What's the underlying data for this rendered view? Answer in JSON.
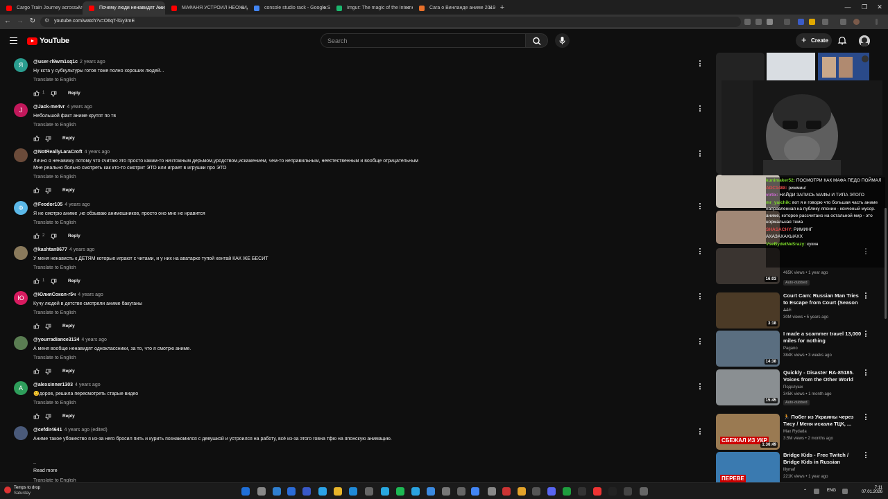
{
  "browser": {
    "tabs": [
      {
        "label": "Cargo Train Journey across Arg...",
        "color": "#ff0000"
      },
      {
        "label": "Почему люди ненавидят Аниме",
        "color": "#ff0000",
        "active": true
      },
      {
        "label": "МАФАНЯ УСТРОИЛ НЕОЖИДА...",
        "color": "#ff0000"
      },
      {
        "label": "console studio rack - Google Se...",
        "color": "#4285f4"
      },
      {
        "label": "Imgur: The magic of the Interne...",
        "color": "#1bb76e"
      },
      {
        "label": "Сага о Винланде аниме 2019-...",
        "color": "#e8702a"
      }
    ],
    "new_tab": "+",
    "close_glyph": "×",
    "url": "youtube.com/watch?v=O6qT-lGy3mE"
  },
  "header": {
    "logo_text": "YouTube",
    "search_placeholder": "Search",
    "create_label": "Create"
  },
  "comments": [
    {
      "avatar_letter": "Я",
      "avatar_color": "#2a9d8f",
      "handle": "@user-rl9wm1sq1c",
      "time": "2 years ago",
      "text": "Ну кста у субкультуры готов тоже полно хороших людей...",
      "translate": "Translate to English",
      "likes": "1",
      "reply": "Reply"
    },
    {
      "avatar_letter": "J",
      "avatar_color": "#c2185b",
      "handle": "@Jack-me4vr",
      "time": "4 years ago",
      "text": "Небольшой факт аниме крутят по тв",
      "translate": "Translate to English",
      "likes": "",
      "reply": "Reply"
    },
    {
      "avatar_letter": "",
      "avatar_color": "#6b4b3a",
      "handle": "@NotReallyLaraCroft",
      "time": "4 years ago",
      "text": "Лично я ненавижу потому что считаю это просто каким-то ничтожным дерьмом,уродством,искажением, чем-то неправильным, неестественным и вообще отрицательным",
      "text2": "Мне реально больно смотреть как кто-то смотрит ЭТО или играет в игрушки про ЭТО",
      "translate": "Translate to English",
      "likes": "",
      "reply": "Reply"
    },
    {
      "avatar_letter": "Ф",
      "avatar_color": "#5bb8e8",
      "handle": "@Feodor105",
      "time": "4 years ago",
      "text": "Я не смотрю аниме ,не обзываю анимешников, просто оно мне не нравится",
      "translate": "Translate to English",
      "likes": "2",
      "reply": "Reply"
    },
    {
      "avatar_letter": "",
      "avatar_color": "#8a7a5c",
      "handle": "@kashtan8677",
      "time": "4 years ago",
      "text": "У меня ненависть к ДЕТЯМ которые играют с читами, и у них на аватарке тупой хентай КАК ЖЕ БЕСИТ",
      "translate": "Translate to English",
      "likes": "1",
      "reply": "Reply"
    },
    {
      "avatar_letter": "Ю",
      "avatar_color": "#d81b60",
      "handle": "@ЮлияСокол-г5ч",
      "time": "4 years ago",
      "text": "Кучу людей в детстве смотрели аниме  бакуганы",
      "translate": "Translate to English",
      "likes": "",
      "reply": "Reply"
    },
    {
      "avatar_letter": "",
      "avatar_color": "#5a7d52",
      "handle": "@yourradiance3134",
      "time": "4 years ago",
      "text": "А меня вообще ненавидят одноклассники, за то, что я смотрю аниме.",
      "translate": "Translate to English",
      "likes": "",
      "reply": "Reply"
    },
    {
      "avatar_letter": "A",
      "avatar_color": "#2e9e5b",
      "handle": "@alexsinner1303",
      "time": "4 years ago",
      "text": "😊доров, решила пересмотреть старые видео",
      "translate": "Translate to English",
      "likes": "",
      "reply": "Reply"
    },
    {
      "avatar_letter": "",
      "avatar_color": "#4a5a7a",
      "handle": "@cefdir4641",
      "time": "4 years ago (edited)",
      "text": "Аниме такое убожество я из-за него бросил пить и курить познакомился с девушкой и устроился на работу, всё из-за этого говна тфю на японскую анимацию.",
      "text2": "..",
      "translate": "",
      "likes": "",
      "reply": ""
    }
  ],
  "read_more": "Read more",
  "last_translate": "Translate to English",
  "sidebar": {
    "videos": [
      {
        "title": "",
        "channel": "",
        "meta": "465K views • 1 year ago",
        "badge": "Auto-dubbed",
        "duration": "16:03",
        "thumb": "#3a3430"
      },
      {
        "title": "Court Cam: Russian Man Tries to Escape from Court (Season ...",
        "channel": "A&E",
        "meta": "30M views • 5 years ago",
        "badge": "",
        "duration": "3:18",
        "thumb": "#4b3a26"
      },
      {
        "title": "I made a scammer travel 13,000 miles for nothing",
        "channel": "Pagano",
        "meta": "384K views • 3 weeks ago",
        "badge": "",
        "duration": "14:38",
        "thumb": "#5a6e80"
      },
      {
        "title": "Quickly - Disaster RA-85185. Voices from the Other World",
        "channel": "Подслушх",
        "meta": "345K views • 1 month ago",
        "badge": "Auto-dubbed",
        "duration": "15:45",
        "thumb": "#8a8f92"
      },
      {
        "title": "🏃 Побег из Украины через Тису / Меня искали ТЦК, ...",
        "channel": "Max Rydada",
        "meta": "3.5M views • 2 months ago",
        "badge": "",
        "duration": "1:36:49",
        "thumb": "#9a7a52",
        "thumb_text": "СБЕЖАЛ ИЗ УКР"
      },
      {
        "title": "Bridge Kids - Free Twitch / Bridge Kids in Russian",
        "channel": "lllymaf",
        "meta": "221K views • 1 year ago",
        "badge": "",
        "duration": "",
        "thumb": "#3a7ab0",
        "thumb_text": "ПЕРЕВЕ"
      }
    ],
    "partial_top": {
      "channel_line": "",
      "meta_line": "",
      "duration": "10:1"
    },
    "hidden_rows": [
      {
        "meta": "1 year ago",
        "text": "Bridge Kids..."
      }
    ]
  },
  "chat_overlay": [
    {
      "user": "kunimaker52:",
      "msg": "ПОСМОТРИ КАК МАФА ПЕДО ПОЙМАЛ",
      "type": "g"
    },
    {
      "user": "ADC1488:",
      "msg": "римминг",
      "type": "r"
    },
    {
      "user": "virtix:",
      "msg": "НАЙДИ ЗАПИСЬ МАФЫ И ТИПА ЭТОГО",
      "type": "v"
    },
    {
      "user": "mr_yaichik:",
      "msg": "вот я и говорю что большая часть аниме направленная на публику японии - конченый мусор. аниме, которое рассчитано на остальной мир - это нормальная тема",
      "type": "g"
    },
    {
      "user": "SHASACHY:",
      "msg": "РИМИНГ",
      "type": "r"
    },
    {
      "user": "",
      "msg": "АХАЗАХАХЫАХХ",
      "type": "g"
    },
    {
      "user": "VseBydetNeSrazy:",
      "msg": "кукин",
      "type": "g"
    }
  ],
  "taskbar": {
    "weather_title": "Temps to drop",
    "weather_sub": "Saturday",
    "lang": "ENG",
    "time": "7:11",
    "date": "07.01.2026"
  }
}
